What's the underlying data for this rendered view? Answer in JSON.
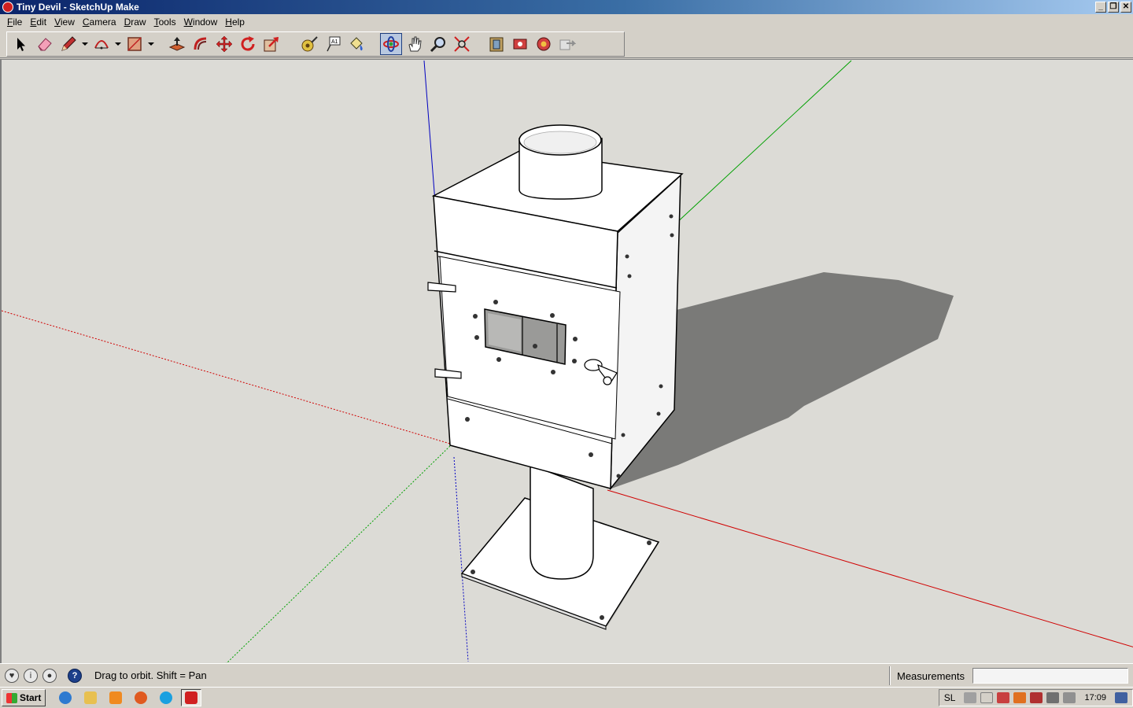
{
  "window": {
    "title": "Tiny Devil - SketchUp Make",
    "controls": [
      "minimize",
      "restore",
      "close"
    ]
  },
  "menubar": {
    "items": [
      "File",
      "Edit",
      "View",
      "Camera",
      "Draw",
      "Tools",
      "Window",
      "Help"
    ]
  },
  "toolbar": {
    "tools": [
      {
        "name": "select-tool",
        "icon": "arrow-cursor-icon"
      },
      {
        "name": "eraser-tool",
        "icon": "eraser-icon"
      },
      {
        "name": "line-tool",
        "icon": "pencil-icon",
        "dropdown": true
      },
      {
        "name": "arc-tool",
        "icon": "arc-icon",
        "dropdown": true
      },
      {
        "name": "shape-tool",
        "icon": "rectangle-icon",
        "dropdown": true
      },
      {
        "name": "push-pull-tool",
        "icon": "push-pull-icon"
      },
      {
        "name": "offset-tool",
        "icon": "offset-icon"
      },
      {
        "name": "move-tool",
        "icon": "move-icon"
      },
      {
        "name": "rotate-tool",
        "icon": "rotate-icon"
      },
      {
        "name": "scale-tool",
        "icon": "scale-icon"
      },
      {
        "name": "tape-measure-tool",
        "icon": "tape-measure-icon"
      },
      {
        "name": "text-tool",
        "icon": "text-label-icon"
      },
      {
        "name": "paint-bucket-tool",
        "icon": "paint-bucket-icon"
      },
      {
        "name": "orbit-tool",
        "icon": "orbit-icon",
        "active": true
      },
      {
        "name": "pan-tool",
        "icon": "hand-icon"
      },
      {
        "name": "zoom-tool",
        "icon": "magnifier-icon"
      },
      {
        "name": "zoom-extents-tool",
        "icon": "zoom-extents-icon"
      },
      {
        "name": "warehouse-tool",
        "icon": "warehouse-icon"
      },
      {
        "name": "share-model-tool",
        "icon": "share-model-icon"
      },
      {
        "name": "extension-warehouse-tool",
        "icon": "extension-warehouse-icon"
      },
      {
        "name": "layout-tool",
        "icon": "send-to-layout-icon"
      }
    ]
  },
  "statusbar": {
    "message": "Drag to orbit.  Shift = Pan",
    "measurements_label": "Measurements",
    "measurements_value": "",
    "icons": [
      "geo-location-icon",
      "credits-icon",
      "user-icon",
      "help-icon"
    ]
  },
  "taskbar": {
    "start_label": "Start",
    "quick_launch": [
      "internet-explorer-icon",
      "file-explorer-icon",
      "media-player-icon",
      "firefox-icon",
      "skype-icon",
      "sketchup-icon"
    ],
    "language": "SL",
    "clock": "17:09"
  },
  "colors": {
    "viewport_bg": "#dcdbd6",
    "axis_red": "#d00000",
    "axis_green": "#00a000",
    "axis_blue": "#0000c0",
    "model_face": "#ffffff",
    "shadow": "#7a7a78"
  }
}
